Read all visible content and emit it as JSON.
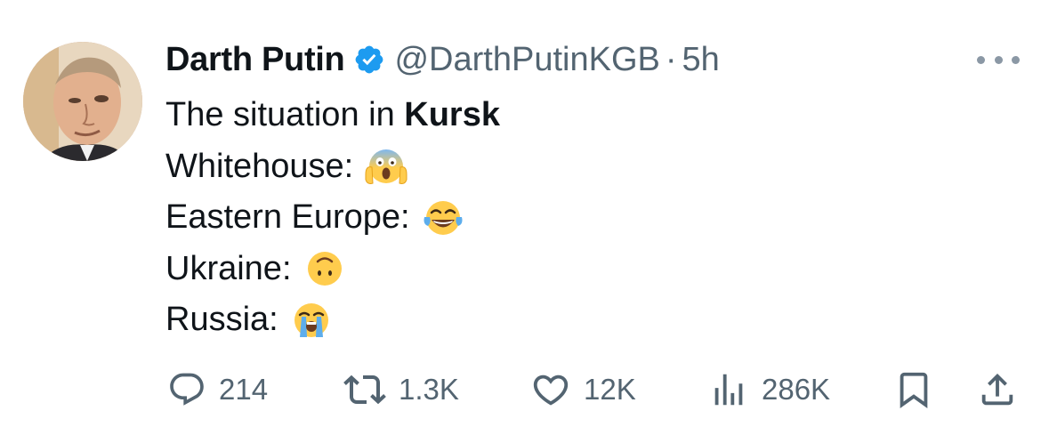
{
  "tweet": {
    "author": {
      "display_name": "Darth Putin",
      "handle": "@DarthPutinKGB",
      "verified": true
    },
    "separator": "·",
    "time": "5h",
    "text": {
      "line1_prefix": "The situation in ",
      "line1_bold": "Kursk",
      "lines": [
        {
          "label": "Whitehouse:",
          "emoji": "face-screaming-in-fear"
        },
        {
          "label": "Eastern Europe:",
          "emoji": "face-with-tears-of-joy"
        },
        {
          "label": "Ukraine:",
          "emoji": "upside-down-face"
        },
        {
          "label": "Russia:",
          "emoji": "loudly-crying-face"
        }
      ]
    },
    "metrics": {
      "replies": "214",
      "reposts": "1.3K",
      "likes": "12K",
      "views": "286K"
    }
  },
  "colors": {
    "text_primary": "#0f1419",
    "text_secondary": "#536471",
    "verified_blue": "#1d9bf0",
    "emoji_yellow": "#ffcc4d"
  }
}
